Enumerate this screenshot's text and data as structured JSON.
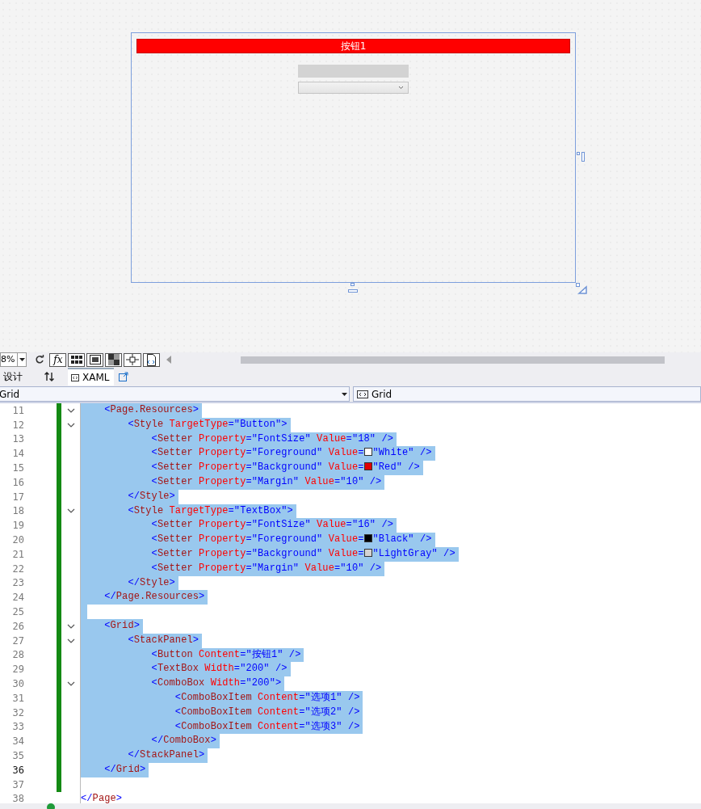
{
  "designer": {
    "button_label": "按钮1"
  },
  "toolbar": {
    "zoom": "8%",
    "formula_button": "fx"
  },
  "tabs": [
    {
      "label": "设计",
      "selected": false
    },
    {
      "label": "XAML",
      "selected": true
    }
  ],
  "nav": {
    "left": "Grid",
    "right": "Grid"
  },
  "lines": [
    {
      "number": "11",
      "fold": true,
      "selected": true,
      "current": false,
      "changed": true,
      "tokens": [
        {
          "kind": "plain",
          "text": "    <"
        },
        {
          "kind": "element",
          "text": "Page.Resources"
        },
        {
          "kind": "plain",
          "text": ">"
        }
      ]
    },
    {
      "number": "12",
      "fold": true,
      "selected": true,
      "current": false,
      "changed": true,
      "tokens": [
        {
          "kind": "plain",
          "text": "        <"
        },
        {
          "kind": "element",
          "text": "Style"
        },
        {
          "kind": "attr",
          "text": " TargetType"
        },
        {
          "kind": "plain",
          "text": "=\"Button\">"
        }
      ]
    },
    {
      "number": "13",
      "fold": false,
      "selected": true,
      "current": false,
      "changed": true,
      "tokens": [
        {
          "kind": "plain",
          "text": "            <"
        },
        {
          "kind": "element",
          "text": "Setter"
        },
        {
          "kind": "attr",
          "text": " Property"
        },
        {
          "kind": "plain",
          "text": "=\"FontSize\" "
        },
        {
          "kind": "attr",
          "text": "Value"
        },
        {
          "kind": "plain",
          "text": "=\"18\" />"
        }
      ]
    },
    {
      "number": "14",
      "fold": false,
      "selected": true,
      "current": false,
      "changed": true,
      "tokens": [
        {
          "kind": "plain",
          "text": "            <"
        },
        {
          "kind": "element",
          "text": "Setter"
        },
        {
          "kind": "attr",
          "text": " Property"
        },
        {
          "kind": "plain",
          "text": "=\"Foreground\" "
        },
        {
          "kind": "attr",
          "text": "Value"
        },
        {
          "kind": "plain",
          "text": "="
        },
        {
          "kind": "swatch",
          "color": "#ffffff"
        },
        {
          "kind": "plain",
          "text": "\"White\" />"
        }
      ]
    },
    {
      "number": "15",
      "fold": false,
      "selected": true,
      "current": false,
      "changed": true,
      "tokens": [
        {
          "kind": "plain",
          "text": "            <"
        },
        {
          "kind": "element",
          "text": "Setter"
        },
        {
          "kind": "attr",
          "text": " Property"
        },
        {
          "kind": "plain",
          "text": "=\"Background\" "
        },
        {
          "kind": "attr",
          "text": "Value"
        },
        {
          "kind": "plain",
          "text": "="
        },
        {
          "kind": "swatch",
          "color": "#e00000"
        },
        {
          "kind": "plain",
          "text": "\"Red\" />"
        }
      ]
    },
    {
      "number": "16",
      "fold": false,
      "selected": true,
      "current": false,
      "changed": true,
      "tokens": [
        {
          "kind": "plain",
          "text": "            <"
        },
        {
          "kind": "element",
          "text": "Setter"
        },
        {
          "kind": "attr",
          "text": " Property"
        },
        {
          "kind": "plain",
          "text": "=\"Margin\" "
        },
        {
          "kind": "attr",
          "text": "Value"
        },
        {
          "kind": "plain",
          "text": "=\"10\" />"
        }
      ]
    },
    {
      "number": "17",
      "fold": false,
      "selected": true,
      "current": false,
      "changed": true,
      "tokens": [
        {
          "kind": "plain",
          "text": "        </"
        },
        {
          "kind": "element",
          "text": "Style"
        },
        {
          "kind": "plain",
          "text": ">"
        }
      ]
    },
    {
      "number": "18",
      "fold": true,
      "selected": true,
      "current": false,
      "changed": true,
      "tokens": [
        {
          "kind": "plain",
          "text": "        <"
        },
        {
          "kind": "element",
          "text": "Style"
        },
        {
          "kind": "attr",
          "text": " TargetType"
        },
        {
          "kind": "plain",
          "text": "=\"TextBox\">"
        }
      ]
    },
    {
      "number": "19",
      "fold": false,
      "selected": true,
      "current": false,
      "changed": true,
      "tokens": [
        {
          "kind": "plain",
          "text": "            <"
        },
        {
          "kind": "element",
          "text": "Setter"
        },
        {
          "kind": "attr",
          "text": " Property"
        },
        {
          "kind": "plain",
          "text": "=\"FontSize\" "
        },
        {
          "kind": "attr",
          "text": "Value"
        },
        {
          "kind": "plain",
          "text": "=\"16\" />"
        }
      ]
    },
    {
      "number": "20",
      "fold": false,
      "selected": true,
      "current": false,
      "changed": true,
      "tokens": [
        {
          "kind": "plain",
          "text": "            <"
        },
        {
          "kind": "element",
          "text": "Setter"
        },
        {
          "kind": "attr",
          "text": " Property"
        },
        {
          "kind": "plain",
          "text": "=\"Foreground\" "
        },
        {
          "kind": "attr",
          "text": "Value"
        },
        {
          "kind": "plain",
          "text": "="
        },
        {
          "kind": "swatch",
          "color": "#000000"
        },
        {
          "kind": "plain",
          "text": "\"Black\" />"
        }
      ]
    },
    {
      "number": "21",
      "fold": false,
      "selected": true,
      "current": false,
      "changed": true,
      "tokens": [
        {
          "kind": "plain",
          "text": "            <"
        },
        {
          "kind": "element",
          "text": "Setter"
        },
        {
          "kind": "attr",
          "text": " Property"
        },
        {
          "kind": "plain",
          "text": "=\"Background\" "
        },
        {
          "kind": "attr",
          "text": "Value"
        },
        {
          "kind": "plain",
          "text": "="
        },
        {
          "kind": "swatch",
          "color": "#d3d3d3"
        },
        {
          "kind": "plain",
          "text": "\"LightGray\" />"
        }
      ]
    },
    {
      "number": "22",
      "fold": false,
      "selected": true,
      "current": false,
      "changed": true,
      "tokens": [
        {
          "kind": "plain",
          "text": "            <"
        },
        {
          "kind": "element",
          "text": "Setter"
        },
        {
          "kind": "attr",
          "text": " Property"
        },
        {
          "kind": "plain",
          "text": "=\"Margin\" "
        },
        {
          "kind": "attr",
          "text": "Value"
        },
        {
          "kind": "plain",
          "text": "=\"10\" />"
        }
      ]
    },
    {
      "number": "23",
      "fold": false,
      "selected": true,
      "current": false,
      "changed": true,
      "tokens": [
        {
          "kind": "plain",
          "text": "        </"
        },
        {
          "kind": "element",
          "text": "Style"
        },
        {
          "kind": "plain",
          "text": ">"
        }
      ]
    },
    {
      "number": "24",
      "fold": false,
      "selected": true,
      "current": false,
      "changed": true,
      "tokens": [
        {
          "kind": "plain",
          "text": "    </"
        },
        {
          "kind": "element",
          "text": "Page.Resources"
        },
        {
          "kind": "plain",
          "text": ">"
        }
      ]
    },
    {
      "number": "25",
      "fold": false,
      "selected": true,
      "current": false,
      "changed": true
    },
    {
      "number": "26",
      "fold": true,
      "selected": true,
      "current": false,
      "changed": true,
      "tokens": [
        {
          "kind": "plain",
          "text": "    <"
        },
        {
          "kind": "element",
          "text": "Grid"
        },
        {
          "kind": "plain",
          "text": ">"
        }
      ]
    },
    {
      "number": "27",
      "fold": true,
      "selected": true,
      "current": false,
      "changed": true,
      "tokens": [
        {
          "kind": "plain",
          "text": "        <"
        },
        {
          "kind": "element",
          "text": "StackPanel"
        },
        {
          "kind": "plain",
          "text": ">"
        }
      ]
    },
    {
      "number": "28",
      "fold": false,
      "selected": true,
      "current": false,
      "changed": true,
      "tokens": [
        {
          "kind": "plain",
          "text": "            <"
        },
        {
          "kind": "element",
          "text": "Button"
        },
        {
          "kind": "attr",
          "text": " Content"
        },
        {
          "kind": "plain",
          "text": "=\"按钮1\" />"
        }
      ]
    },
    {
      "number": "29",
      "fold": false,
      "selected": true,
      "current": false,
      "changed": true,
      "tokens": [
        {
          "kind": "plain",
          "text": "            <"
        },
        {
          "kind": "element",
          "text": "TextBox"
        },
        {
          "kind": "attr",
          "text": " Width"
        },
        {
          "kind": "plain",
          "text": "=\"200\" />"
        }
      ]
    },
    {
      "number": "30",
      "fold": true,
      "selected": true,
      "current": false,
      "changed": true,
      "tokens": [
        {
          "kind": "plain",
          "text": "            <"
        },
        {
          "kind": "element",
          "text": "ComboBox"
        },
        {
          "kind": "attr",
          "text": " Width"
        },
        {
          "kind": "plain",
          "text": "=\"200\">"
        }
      ]
    },
    {
      "number": "31",
      "fold": false,
      "selected": true,
      "current": false,
      "changed": true,
      "tokens": [
        {
          "kind": "plain",
          "text": "                <"
        },
        {
          "kind": "element",
          "text": "ComboBoxItem"
        },
        {
          "kind": "attr",
          "text": " Content"
        },
        {
          "kind": "plain",
          "text": "=\"选项1\" />"
        }
      ]
    },
    {
      "number": "32",
      "fold": false,
      "selected": true,
      "current": false,
      "changed": true,
      "tokens": [
        {
          "kind": "plain",
          "text": "                <"
        },
        {
          "kind": "element",
          "text": "ComboBoxItem"
        },
        {
          "kind": "attr",
          "text": " Content"
        },
        {
          "kind": "plain",
          "text": "=\"选项2\" />"
        }
      ]
    },
    {
      "number": "33",
      "fold": false,
      "selected": true,
      "current": false,
      "changed": true,
      "tokens": [
        {
          "kind": "plain",
          "text": "                <"
        },
        {
          "kind": "element",
          "text": "ComboBoxItem"
        },
        {
          "kind": "attr",
          "text": " Content"
        },
        {
          "kind": "plain",
          "text": "=\"选项3\" />"
        }
      ]
    },
    {
      "number": "34",
      "fold": false,
      "selected": true,
      "current": false,
      "changed": true,
      "tokens": [
        {
          "kind": "plain",
          "text": "            </"
        },
        {
          "kind": "element",
          "text": "ComboBox"
        },
        {
          "kind": "plain",
          "text": ">"
        }
      ]
    },
    {
      "number": "35",
      "fold": false,
      "selected": true,
      "current": false,
      "changed": true,
      "tokens": [
        {
          "kind": "plain",
          "text": "        </"
        },
        {
          "kind": "element",
          "text": "StackPanel"
        },
        {
          "kind": "plain",
          "text": ">"
        }
      ]
    },
    {
      "number": "36",
      "fold": false,
      "selected": true,
      "current": true,
      "changed": true,
      "tokens": [
        {
          "kind": "plain",
          "text": "    </"
        },
        {
          "kind": "element",
          "text": "Grid"
        },
        {
          "kind": "plain",
          "text": ">"
        }
      ]
    },
    {
      "number": "37",
      "fold": false,
      "selected": false,
      "current": false,
      "changed": true
    },
    {
      "number": "38",
      "fold": false,
      "selected": false,
      "current": false,
      "changed": false,
      "tokens": [
        {
          "kind": "plain",
          "text": "</"
        },
        {
          "kind": "element",
          "text": "Page"
        },
        {
          "kind": "plain",
          "text": ">"
        }
      ]
    }
  ]
}
